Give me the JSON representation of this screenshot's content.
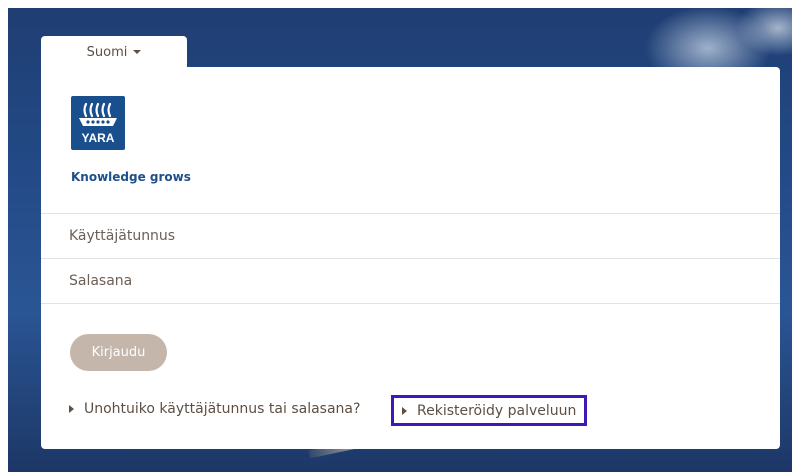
{
  "language": {
    "selected": "Suomi"
  },
  "brand": {
    "name": "YARA",
    "tagline": "Knowledge grows"
  },
  "form": {
    "username_placeholder": "Käyttäjätunnus",
    "password_placeholder": "Salasana",
    "login_label": "Kirjaudu"
  },
  "links": {
    "forgot": "Unohtuiko käyttäjätunnus tai salasana?",
    "register": "Rekisteröidy palveluun"
  },
  "colors": {
    "brand_blue": "#1a4f8e",
    "button": "#c4b6aa",
    "highlight": "#3f18b8"
  }
}
